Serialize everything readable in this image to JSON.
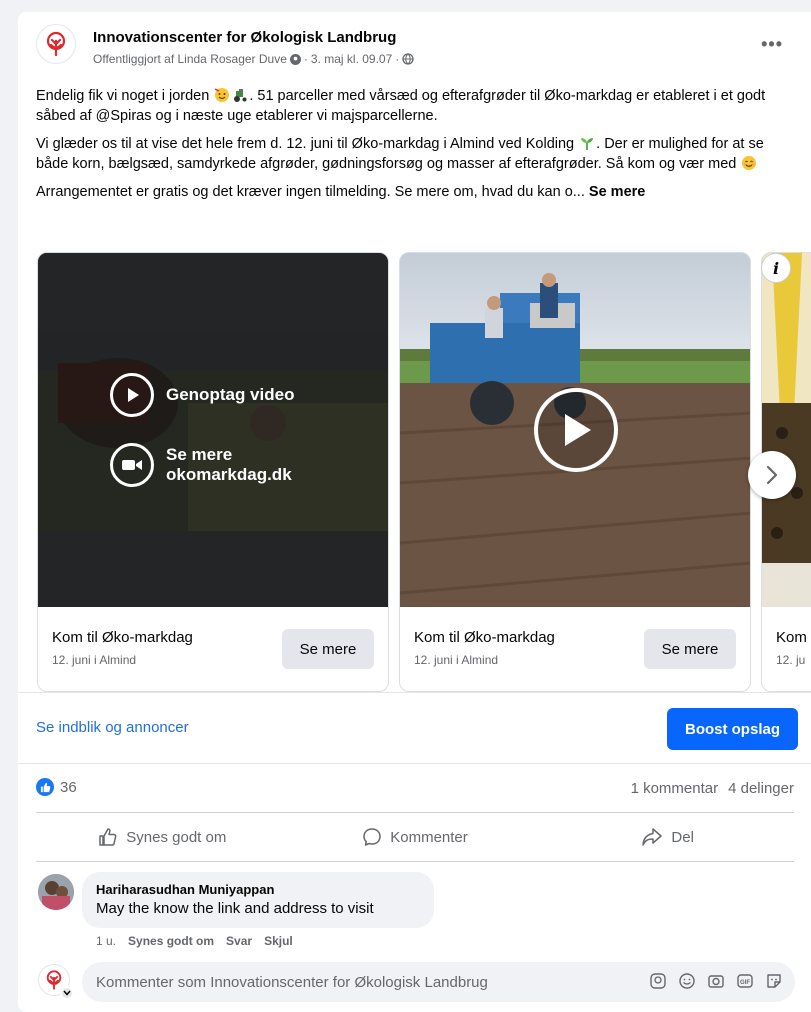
{
  "post": {
    "page_name": "Innovationscenter for Økologisk Landbrug",
    "published_by": "Offentliggjort af Linda Rosager Duve",
    "date": "3. maj kl. 09.07",
    "sep": "·",
    "paragraph_1_a": "Endelig fik vi noget i jorden",
    "paragraph_1_b": ". 51 parceller med vårsæd og efterafgrøder til Øko-markdag er etableret i et godt såbed af @Spiras og i næste uge etablerer vi majsparcellerne.",
    "paragraph_2_a": "Vi glæder os til at vise det hele frem d. 12. juni til Øko-markdag i Almind ved Kolding",
    "paragraph_2_b": ". Der er mulighed for at se både korn, bælgsæd, samdyrkede afgrøder, gødningsforsøg og masser af efterafgrøder. Så kom og vær med",
    "paragraph_3": "Arrangementet er gratis og det kræver ingen tilmelding. Se mere om, hvad du kan o...",
    "see_more": "Se mere"
  },
  "carousel": {
    "items": [
      {
        "title": "Kom til Øko-markdag",
        "subtitle": "12. juni i Almind",
        "button": "Se mere",
        "overlay_resume": "Genoptag video",
        "overlay_see_more_1": "Se mere",
        "overlay_see_more_2": "okomarkdag.dk"
      },
      {
        "title": "Kom til Øko-markdag",
        "subtitle": "12. juni i Almind",
        "button": "Se mere"
      },
      {
        "title": "Kom",
        "subtitle": "12. ju"
      }
    ],
    "info_badge": "i"
  },
  "insights": {
    "link": "Se indblik og annoncer",
    "boost": "Boost opslag"
  },
  "stats": {
    "likes": "36",
    "comments": "1 kommentar",
    "shares": "4 delinger"
  },
  "actions": {
    "like": "Synes godt om",
    "comment": "Kommenter",
    "share": "Del"
  },
  "comment": {
    "author": "Hariharasudhan Muniyappan",
    "text": "May the know the link and address to visit",
    "age": "1 u.",
    "like": "Synes godt om",
    "reply": "Svar",
    "hide": "Skjul"
  },
  "composer": {
    "placeholder": "Kommenter som Innovationscenter for Økologisk Landbrug"
  },
  "colors": {
    "brand_red": "#e0282f",
    "link_blue": "#216fdb",
    "boost_blue": "#0866ff"
  }
}
